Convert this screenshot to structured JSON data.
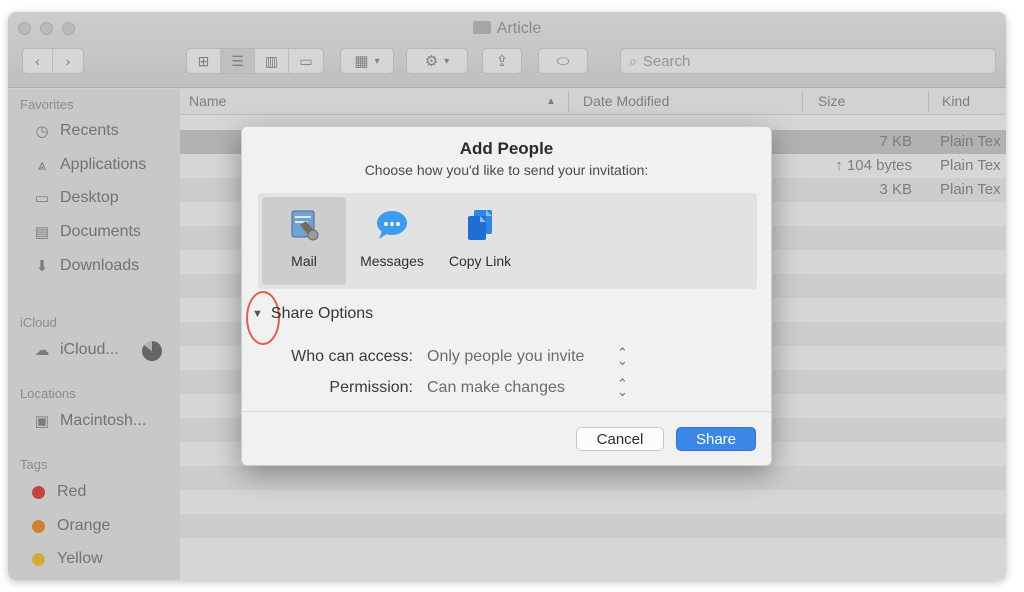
{
  "window": {
    "title": "Article"
  },
  "toolbar": {
    "back_icon": "chevron-left-icon",
    "forward_icon": "chevron-right-icon",
    "search_placeholder": "Search"
  },
  "sidebar": {
    "sections": [
      {
        "header": "Favorites",
        "items": [
          {
            "label": "Recents",
            "icon": "clock-icon"
          },
          {
            "label": "Applications",
            "icon": "applications-icon"
          },
          {
            "label": "Desktop",
            "icon": "desktop-icon"
          },
          {
            "label": "Documents",
            "icon": "document-icon"
          },
          {
            "label": "Downloads",
            "icon": "download-icon"
          }
        ]
      },
      {
        "header": "iCloud",
        "items": [
          {
            "label": "iCloud...",
            "icon": "cloud-icon"
          }
        ]
      },
      {
        "header": "Locations",
        "items": [
          {
            "label": "Macintosh...",
            "icon": "disk-icon"
          }
        ]
      },
      {
        "header": "Tags",
        "items": [
          {
            "label": "Red",
            "color": "#e0443e"
          },
          {
            "label": "Orange",
            "color": "#ef8e2f"
          },
          {
            "label": "Yellow",
            "color": "#eec33a"
          }
        ]
      }
    ]
  },
  "filelist": {
    "columns": [
      "Name",
      "Date Modified",
      "Size",
      "Kind"
    ],
    "rows": [
      {
        "size": "7 KB",
        "kind": "Plain Tex"
      },
      {
        "size": "↑ 104 bytes",
        "kind": "Plain Tex"
      },
      {
        "size": "3 KB",
        "kind": "Plain Tex"
      }
    ]
  },
  "dialog": {
    "title": "Add People",
    "subtitle": "Choose how you'd like to send your invitation:",
    "services": [
      {
        "label": "Mail",
        "icon": "mail-icon",
        "selected": true
      },
      {
        "label": "Messages",
        "icon": "messages-icon",
        "selected": false
      },
      {
        "label": "Copy Link",
        "icon": "copy-link-icon",
        "selected": false
      }
    ],
    "share_options_label": "Share Options",
    "who_can_access_label": "Who can access:",
    "who_can_access_value": "Only people you invite",
    "permission_label": "Permission:",
    "permission_value": "Can make changes",
    "cancel_label": "Cancel",
    "share_label": "Share",
    "accent_color": "#3a87e8",
    "highlight_color": "#e55c4f"
  }
}
